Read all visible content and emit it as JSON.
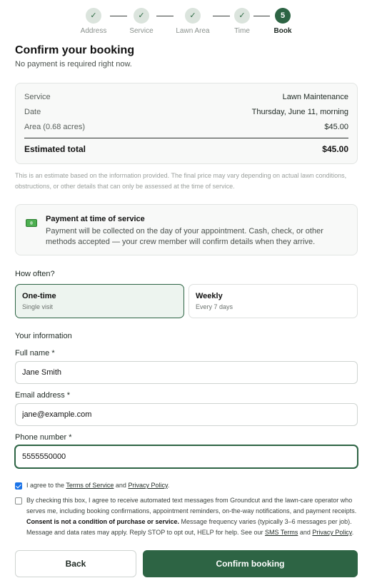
{
  "stepper": {
    "steps": [
      {
        "label": "Address",
        "mark": "✓"
      },
      {
        "label": "Service",
        "mark": "✓"
      },
      {
        "label": "Lawn Area",
        "mark": "✓"
      },
      {
        "label": "Time",
        "mark": "✓"
      },
      {
        "label": "Book",
        "mark": "5"
      }
    ]
  },
  "header": {
    "title": "Confirm your booking",
    "subtitle": "No payment is required right now."
  },
  "summary": {
    "rows": [
      {
        "key": "Service",
        "value": "Lawn Maintenance"
      },
      {
        "key": "Date",
        "value": "Thursday, June 11, morning"
      },
      {
        "key": "Area (0.68 acres)",
        "value": "$45.00"
      }
    ],
    "total_label": "Estimated total",
    "total_value": "$45.00"
  },
  "disclaimer": "This is an estimate based on the information provided. The final price may vary depending on actual lawn conditions, obstructions, or other details that can only be assessed at the time of service.",
  "payment": {
    "icon": "money-icon",
    "title": "Payment at time of service",
    "text": "Payment will be collected on the day of your appointment. Cash, check, or other methods accepted — your crew member will confirm details when they arrive."
  },
  "frequency": {
    "label": "How often?",
    "options": [
      {
        "title": "One-time",
        "sub": "Single visit",
        "selected": true
      },
      {
        "title": "Weekly",
        "sub": "Every 7 days",
        "selected": false
      }
    ]
  },
  "info": {
    "label": "Your information",
    "name_label": "Full name *",
    "name_value": "Jane Smith",
    "email_label": "Email address *",
    "email_value": "jane@example.com",
    "phone_label": "Phone number *",
    "phone_value": "5555550000"
  },
  "consent": {
    "terms_prefix": "I agree to the ",
    "terms_link": "Terms of Service",
    "terms_and": " and ",
    "privacy_link": "Privacy Policy",
    "terms_suffix": ".",
    "sms_text_1": "By checking this box, I agree to receive automated text messages from Groundcut and the lawn-care operator who serves me, including booking confirmations, appointment reminders, on-the-way notifications, and payment receipts. ",
    "sms_bold": "Consent is not a condition of purchase or service.",
    "sms_text_2": " Message frequency varies (typically 3–6 messages per job). Message and data rates may apply. Reply STOP to opt out, HELP for help. See our ",
    "sms_terms_link": "SMS Terms",
    "sms_and": " and ",
    "sms_privacy_link": "Privacy Policy",
    "sms_suffix": "."
  },
  "buttons": {
    "back": "Back",
    "confirm": "Confirm booking"
  },
  "colors": {
    "brand": "#2d6444",
    "checkbox": "#1a73e8"
  }
}
